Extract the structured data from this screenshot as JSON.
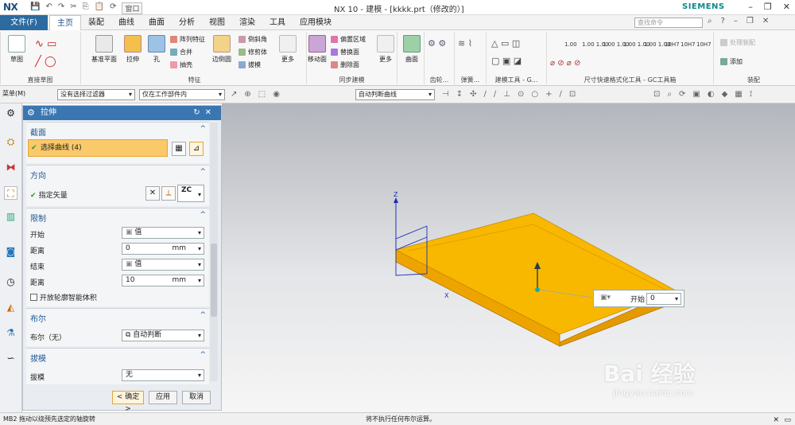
{
  "app": {
    "logo": "NX",
    "title": "NX 10 - 建模 - [kkkk.prt（修改的）]",
    "brand": "SIEMENS",
    "window_menu": "窗口"
  },
  "menu": {
    "file": "文件(F)",
    "tabs": [
      "主页",
      "装配",
      "曲线",
      "曲面",
      "分析",
      "视图",
      "渲染",
      "工具",
      "应用模块"
    ],
    "search_placeholder": "查找命令"
  },
  "ribbon": {
    "groups": {
      "sketch": "直接草图",
      "feature": "特征",
      "sync": "同步建模",
      "gear": "齿轮...",
      "spring": "弹簧...",
      "weld": "建模工具 - G...",
      "dim": "尺寸快速格式化工具 - GC工具箱",
      "assembly": "装配"
    },
    "buttons": {
      "sketch": "草图",
      "datum": "基准平面",
      "extrude": "拉伸",
      "hole": "孔",
      "pattern": "阵列特征",
      "unite": "合并",
      "shell": "抽壳",
      "edge_blend": "边倒圆",
      "chamfer": "倒斜角",
      "trim": "修剪体",
      "draft": "拔模",
      "more1": "更多",
      "move_face": "移动面",
      "offset_region": "偏置区域",
      "replace_face": "替换面",
      "delete_face": "删除面",
      "more2": "更多",
      "surface": "曲面",
      "add": "添加",
      "constraint": "处理装配"
    },
    "dim_values": [
      "1.00",
      "1.00\n1.00",
      "1.00\n1.00",
      "1.00\n1.00",
      "1.00\n1.00",
      "10H7",
      "10H7",
      "10H7"
    ]
  },
  "toolbar2": {
    "menu": "菜单(M)",
    "filter": "没有选择过滤器",
    "scope": "仅在工作部件内",
    "curve_rule": "自动判断曲线"
  },
  "dialog": {
    "title": "拉伸",
    "sections": {
      "section": {
        "title": "截面",
        "select_curve": "选择曲线 (4)"
      },
      "direction": {
        "title": "方向",
        "vector_label": "指定矢量",
        "vector_value": "ZC"
      },
      "limits": {
        "title": "限制",
        "start_label": "开始",
        "start_value": "值",
        "start_distance_label": "距离",
        "start_distance": "0",
        "end_label": "结束",
        "end_value": "值",
        "end_distance_label": "距离",
        "end_distance": "10",
        "unit": "mm",
        "open_profile": "开放轮廓智能体积"
      },
      "boolean": {
        "title": "布尔",
        "label": "布尔（无）",
        "value": "自动判断"
      },
      "draft": {
        "title": "拔模",
        "label": "拔模",
        "value": "无"
      }
    },
    "buttons": {
      "ok": "< 确定 >",
      "apply": "应用",
      "cancel": "取消"
    }
  },
  "viewport": {
    "float_label": "开始",
    "float_value": "0",
    "axis_z": "Z",
    "axis_x": "X",
    "body_color": "#f5b400",
    "edge_color": "#c98a00"
  },
  "status": {
    "left": "MB2 拖动以绕预先选定的轴旋转",
    "center": "将不执行任何布尔运算。"
  },
  "watermark": {
    "main": "Bai  经验",
    "sub": "jingyan.baidu.com"
  }
}
